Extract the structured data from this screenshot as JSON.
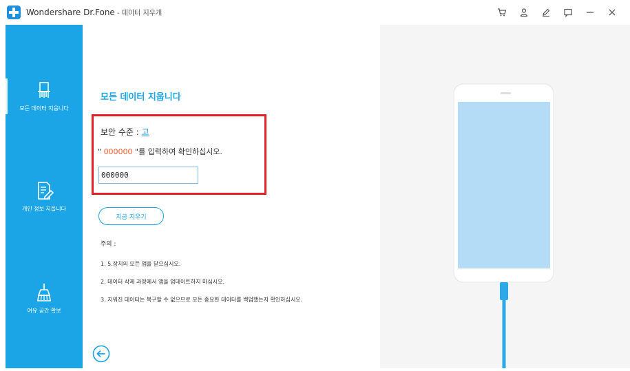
{
  "app": {
    "title": "Wondershare Dr.Fone",
    "subtitle": " - 데이터 지우개"
  },
  "window_controls": [
    "cart-icon",
    "user-icon",
    "edit-icon",
    "feedback-icon",
    "minimize-icon",
    "close-icon"
  ],
  "sidebar": {
    "items": [
      {
        "label": "모든 데이터 지웁니다",
        "icon": "erase-all-icon",
        "selected": true
      },
      {
        "label": "개인 정보 지웁니다",
        "icon": "private-data-icon",
        "selected": false
      },
      {
        "label": "여유 공간 확보",
        "icon": "broom-icon",
        "selected": false
      }
    ]
  },
  "main": {
    "heading": "모든 데이터 지웁니다",
    "security_label": "보안 수준 : ",
    "security_level": "고",
    "confirm_prefix": "\" ",
    "confirm_code": "000000",
    "confirm_suffix": " \"를 입력하여 확인하십시오.",
    "input_value": "000000",
    "erase_button": "지금 지우기",
    "note_title": "주의 :",
    "notes": [
      "1. 5.장치의 모든 앱을 닫으십시오.",
      "2. 데이터 삭제 과정에서 앱을 업데이트하지 마십시오.",
      "3. 지워진 데이터는 복구할 수 없으므로 모든 중요한 데이터를 백업했는지 확인하십시오."
    ]
  },
  "colors": {
    "sidebar": "#1ba5e6",
    "accent": "#1ba5e6",
    "highlight_box": "#e01f26",
    "code": "#f05a28",
    "phone_screen": "#b5dcf7",
    "cable": "#2ea9e8"
  }
}
